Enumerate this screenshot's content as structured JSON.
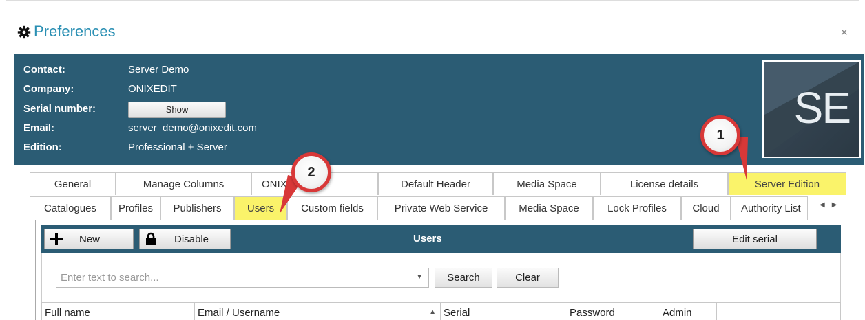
{
  "dialog": {
    "title": "Preferences",
    "close_glyph": "×"
  },
  "info": {
    "contact_label": "Contact:",
    "contact_value": "Server Demo",
    "company_label": "Company:",
    "company_value": "ONIXEDIT",
    "serial_label": "Serial number:",
    "serial_button": "Show",
    "email_label": "Email:",
    "email_value": "server_demo@onixedit.com",
    "edition_label": "Edition:",
    "edition_value": "Professional + Server",
    "logo_text": "SE"
  },
  "tabs_row1": [
    {
      "label": "General"
    },
    {
      "label": "Manage Columns"
    },
    {
      "label": "ONIX v"
    },
    {
      "label": "Default Header"
    },
    {
      "label": "Media Space"
    },
    {
      "label": "License details"
    },
    {
      "label": "Server Edition",
      "highlighted": true
    }
  ],
  "tabs_row2": [
    {
      "label": "Catalogues"
    },
    {
      "label": "Profiles"
    },
    {
      "label": "Publishers"
    },
    {
      "label": "Users",
      "highlighted": true,
      "selected": true
    },
    {
      "label": "Custom fields"
    },
    {
      "label": "Private Web Service"
    },
    {
      "label": "Media Space"
    },
    {
      "label": "Lock Profiles"
    },
    {
      "label": "Cloud"
    },
    {
      "label": "Authority List"
    }
  ],
  "toolbar": {
    "new_label": "New",
    "disable_label": "Disable",
    "title": "Users",
    "edit_serial_label": "Edit serial"
  },
  "search": {
    "placeholder": "Enter text to search...",
    "search_label": "Search",
    "clear_label": "Clear"
  },
  "grid": {
    "columns": [
      "Full name",
      "Email / Username",
      "Serial",
      "Password",
      "Admin"
    ]
  },
  "callouts": [
    "1",
    "2"
  ],
  "colors": {
    "panel": "#2b5c74",
    "title": "#2a8fb3",
    "highlight": "#faf36a",
    "callout_border": "#d83838"
  }
}
